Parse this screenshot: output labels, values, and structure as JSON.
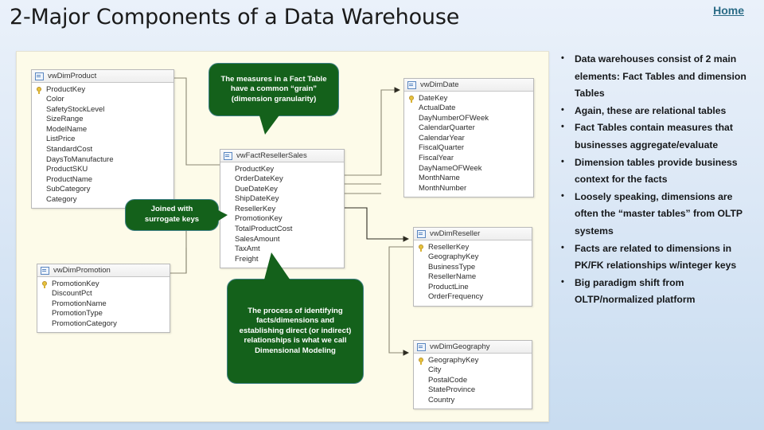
{
  "header": {
    "title": "2-Major Components of a Data Warehouse",
    "home_link": "Home",
    "link_color": "#2a6b86"
  },
  "diagram": {
    "background_color": "#fdfbe9",
    "tables": [
      {
        "id": "product",
        "name": "vwDimProduct",
        "fields": [
          {
            "name": "ProductKey",
            "pk": true
          },
          {
            "name": "Color",
            "pk": false
          },
          {
            "name": "SafetyStockLevel",
            "pk": false
          },
          {
            "name": "SizeRange",
            "pk": false
          },
          {
            "name": "ModelName",
            "pk": false
          },
          {
            "name": "ListPrice",
            "pk": false
          },
          {
            "name": "StandardCost",
            "pk": false
          },
          {
            "name": "DaysToManufacture",
            "pk": false
          },
          {
            "name": "ProductSKU",
            "pk": false
          },
          {
            "name": "ProductName",
            "pk": false
          },
          {
            "name": "SubCategory",
            "pk": false
          },
          {
            "name": "Category",
            "pk": false
          }
        ]
      },
      {
        "id": "promotion",
        "name": "vwDimPromotion",
        "fields": [
          {
            "name": "PromotionKey",
            "pk": true
          },
          {
            "name": "DiscountPct",
            "pk": false
          },
          {
            "name": "PromotionName",
            "pk": false
          },
          {
            "name": "PromotionType",
            "pk": false
          },
          {
            "name": "PromotionCategory",
            "pk": false
          }
        ]
      },
      {
        "id": "fact",
        "name": "vwFactResellerSales",
        "fields": [
          {
            "name": "ProductKey",
            "pk": false
          },
          {
            "name": "OrderDateKey",
            "pk": false
          },
          {
            "name": "DueDateKey",
            "pk": false
          },
          {
            "name": "ShipDateKey",
            "pk": false
          },
          {
            "name": "ResellerKey",
            "pk": false
          },
          {
            "name": "PromotionKey",
            "pk": false
          },
          {
            "name": "TotalProductCost",
            "pk": false
          },
          {
            "name": "SalesAmount",
            "pk": false
          },
          {
            "name": "TaxAmt",
            "pk": false
          },
          {
            "name": "Freight",
            "pk": false
          }
        ]
      },
      {
        "id": "date",
        "name": "vwDimDate",
        "fields": [
          {
            "name": "DateKey",
            "pk": true
          },
          {
            "name": "ActualDate",
            "pk": false
          },
          {
            "name": "DayNumberOFWeek",
            "pk": false
          },
          {
            "name": "CalendarQuarter",
            "pk": false
          },
          {
            "name": "CalendarYear",
            "pk": false
          },
          {
            "name": "FiscalQuarter",
            "pk": false
          },
          {
            "name": "FiscalYear",
            "pk": false
          },
          {
            "name": "DayNameOFWeek",
            "pk": false
          },
          {
            "name": "MonthName",
            "pk": false
          },
          {
            "name": "MonthNumber",
            "pk": false
          }
        ]
      },
      {
        "id": "reseller",
        "name": "vwDimReseller",
        "fields": [
          {
            "name": "ResellerKey",
            "pk": true
          },
          {
            "name": "GeographyKey",
            "pk": false
          },
          {
            "name": "BusinessType",
            "pk": false
          },
          {
            "name": "ResellerName",
            "pk": false
          },
          {
            "name": "ProductLine",
            "pk": false
          },
          {
            "name": "OrderFrequency",
            "pk": false
          }
        ]
      },
      {
        "id": "geography",
        "name": "vwDimGeography",
        "fields": [
          {
            "name": "GeographyKey",
            "pk": true
          },
          {
            "name": "City",
            "pk": false
          },
          {
            "name": "PostalCode",
            "pk": false
          },
          {
            "name": "StateProvince",
            "pk": false
          },
          {
            "name": "Country",
            "pk": false
          }
        ]
      }
    ],
    "callouts": [
      {
        "id": "grain",
        "text": "The measures in a Fact Table have a common “grain” (dimension granularity)",
        "fill": "#14611b"
      },
      {
        "id": "joined",
        "text": "Joined with surrogate keys",
        "fill": "#14611b"
      },
      {
        "id": "modeling",
        "text": "The process of identifying facts/dimensions and establishing direct (or indirect) relationships is what we call Dimensional Modeling",
        "fill": "#14611b"
      }
    ]
  },
  "bullets": {
    "items": [
      "Data warehouses consist of 2 main elements: Fact Tables and dimension Tables",
      "Again, these are relational tables",
      "Fact Tables contain measures that businesses aggregate/evaluate",
      "Dimension tables provide business context for the facts",
      "Loosely speaking, dimensions are often the “master tables” from OLTP systems",
      "Facts are related to dimensions in PK/FK relationships w/integer keys",
      "Big paradigm shift from OLTP/normalized platform"
    ]
  }
}
